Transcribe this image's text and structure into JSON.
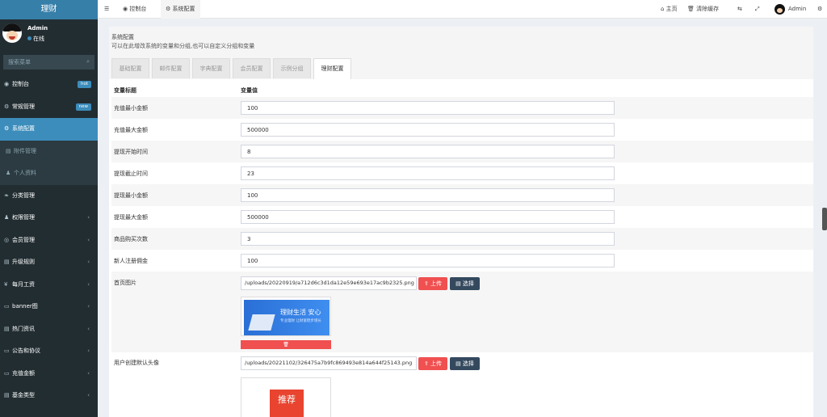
{
  "app": {
    "title": "理财"
  },
  "user": {
    "name": "Admin",
    "status": "在线"
  },
  "search": {
    "placeholder": "搜索菜单"
  },
  "sidebar": {
    "items": [
      {
        "icon": "dashboard-icon",
        "glyph": "◉",
        "label": "控制台",
        "badge": "hot"
      },
      {
        "icon": "cogs-icon",
        "glyph": "⚙",
        "label": "常规管理",
        "badge": "new"
      },
      {
        "icon": "gear-icon",
        "glyph": "⚙",
        "label": "系统配置"
      },
      {
        "icon": "attachment-icon",
        "glyph": "▤",
        "label": "附件管理"
      },
      {
        "icon": "user-icon",
        "glyph": "♟",
        "label": "个人资料"
      },
      {
        "icon": "leaf-icon",
        "glyph": "❧",
        "label": "分类管理"
      },
      {
        "icon": "group-icon",
        "glyph": "♟",
        "label": "权限管理"
      },
      {
        "icon": "member-icon",
        "glyph": "◎",
        "label": "会员管理"
      },
      {
        "icon": "list-icon",
        "glyph": "▤",
        "label": "升级规则"
      },
      {
        "icon": "yen-icon",
        "glyph": "¥",
        "label": "每月工资"
      },
      {
        "icon": "image-icon",
        "glyph": "▭",
        "label": "banner图"
      },
      {
        "icon": "news-icon",
        "glyph": "▤",
        "label": "热门资讯"
      },
      {
        "icon": "notice-icon",
        "glyph": "▭",
        "label": "公告和协议"
      },
      {
        "icon": "money-icon",
        "glyph": "▭",
        "label": "充值金额"
      },
      {
        "icon": "fund-icon",
        "glyph": "▤",
        "label": "基金类型"
      }
    ]
  },
  "topbar": {
    "tabs": [
      {
        "label": "控制台"
      },
      {
        "label": "系统配置"
      }
    ],
    "home": "主页",
    "clear_cache": "清除缓存",
    "admin": "Admin"
  },
  "page": {
    "title": "系统配置",
    "description": "可以在此增改系统的变量和分组,也可以自定义分组和变量",
    "tabs": [
      "基础配置",
      "邮件配置",
      "字典配置",
      "会员配置",
      "示例分组",
      "理财配置"
    ],
    "active_tab": "理财配置"
  },
  "table": {
    "col_title": "变量标题",
    "col_value": "变量值",
    "rows": [
      {
        "label": "充值最小金额",
        "value": "100"
      },
      {
        "label": "充值最大金额",
        "value": "500000"
      },
      {
        "label": "提现开始时间",
        "value": "8"
      },
      {
        "label": "提现截止时间",
        "value": "23"
      },
      {
        "label": "提现最小金额",
        "value": "100"
      },
      {
        "label": "提现最大金额",
        "value": "500000"
      },
      {
        "label": "商品购买次数",
        "value": "3"
      },
      {
        "label": "新人注册佣金",
        "value": "100"
      }
    ],
    "image_rows": [
      {
        "label": "首页图片",
        "value": "/uploads/20220919/a712d6c3d1da12e59e693e17ac9b2325.png",
        "thumb_text": "理财生活 安心",
        "thumb_sub": "专业理财 让财富稳步增长"
      },
      {
        "label": "用户创建默认头像",
        "value": "/uploads/20221102/326475a7b9fc869493e814a644f25143.png",
        "thumb_text": "推荐"
      }
    ],
    "upload_label": "上传",
    "select_label": "选择",
    "delete_glyph": "🗑"
  }
}
